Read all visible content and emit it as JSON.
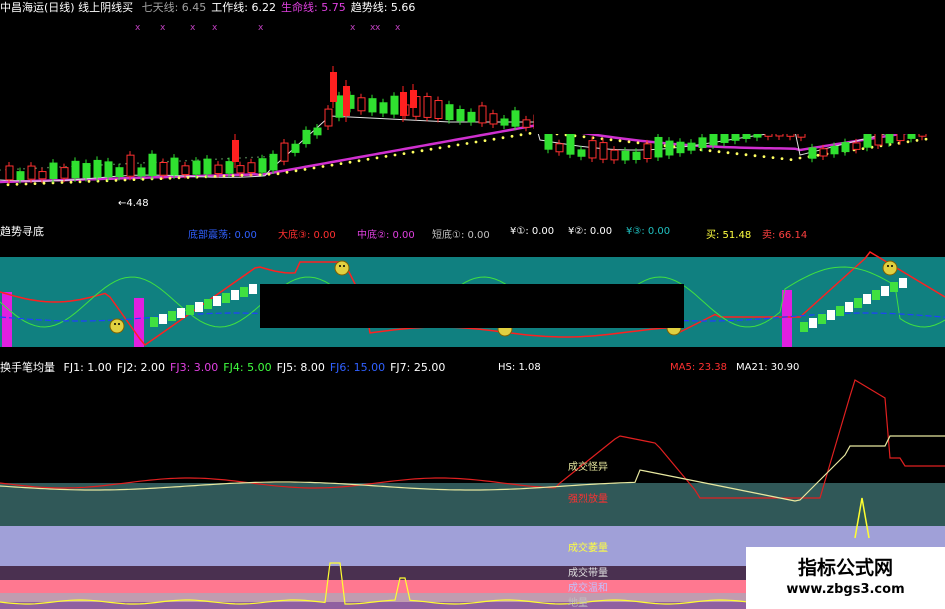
{
  "price_panel": {
    "title": "中昌海运(日线) 线上阴线买",
    "indicators": [
      {
        "label": "七天线:",
        "value": "6.45",
        "color": "#a0a0a0"
      },
      {
        "label": "工作线:",
        "value": "6.22",
        "color": "#ffffff"
      },
      {
        "label": "生命线:",
        "value": "5.75",
        "color": "#e040e0"
      },
      {
        "label": "趋势线:",
        "value": "5.66",
        "color": "#ffffff"
      }
    ],
    "low_marker": "4.48"
  },
  "trend_panel": {
    "title": "趋势寻底",
    "indicators": [
      {
        "label": "底部震荡:",
        "value": "0.00",
        "color": "#3060ff"
      },
      {
        "label": "大底③:",
        "value": "0.00",
        "color": "#ff3030"
      },
      {
        "label": "中底②:",
        "value": "0.00",
        "color": "#e040e0"
      },
      {
        "label": "短底①:",
        "value": "0.00",
        "color": "#c0c0c0"
      },
      {
        "label": "¥①:",
        "value": "0.00",
        "color": "#ffffff"
      },
      {
        "label": "¥②:",
        "value": "0.00",
        "color": "#ffffff"
      },
      {
        "label": "¥③:",
        "value": "0.00",
        "color": "#20c0c0"
      },
      {
        "label": "买:",
        "value": "51.48",
        "color": "#ffff40"
      },
      {
        "label": "卖:",
        "value": "66.14",
        "color": "#ff4040"
      }
    ]
  },
  "volume_panel": {
    "title": "换手笔均量",
    "indicators": [
      {
        "label": "FJ1:",
        "value": "1.00",
        "color": "#ffffff"
      },
      {
        "label": "FJ2:",
        "value": "2.00",
        "color": "#ffffff"
      },
      {
        "label": "FJ3:",
        "value": "3.00",
        "color": "#e040e0"
      },
      {
        "label": "FJ4:",
        "value": "5.00",
        "color": "#40ff40"
      },
      {
        "label": "FJ5:",
        "value": "8.00",
        "color": "#ffffff"
      },
      {
        "label": "FJ6:",
        "value": "15.00",
        "color": "#3060ff"
      },
      {
        "label": "FJ7:",
        "value": "25.00",
        "color": "#ffffff"
      }
    ],
    "hs": {
      "label": "HS:",
      "value": "1.08",
      "color": "#ffffff"
    },
    "ma5": {
      "label": "MA5:",
      "value": "23.38",
      "color": "#ff3030"
    },
    "ma21": {
      "label": "MA21:",
      "value": "30.90",
      "color": "#ffffff"
    },
    "band_labels": {
      "anomaly": "成交怪异",
      "strong": "强烈放量",
      "shrink": "成交萎量",
      "band": "成交带量",
      "moderate": "成交温和",
      "ground": "地量"
    }
  },
  "watermark": {
    "title": "指标公式网",
    "url": "www.zbgs3.com"
  }
}
